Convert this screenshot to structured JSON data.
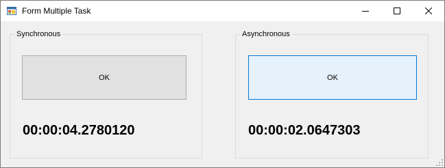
{
  "window": {
    "title": "Form Multiple Task",
    "icons": {
      "app": "form-app-icon",
      "minimize": "minimize-icon",
      "maximize": "maximize-icon",
      "close": "close-icon"
    }
  },
  "groups": {
    "sync": {
      "legend": "Synchronous",
      "button_label": "OK",
      "elapsed": "00:00:04.2780120"
    },
    "async": {
      "legend": "Asynchronous",
      "button_label": "OK",
      "elapsed": "00:00:02.0647303"
    }
  },
  "colors": {
    "accent_border": "#0078d7",
    "focused_button_bg": "#e5f1fb",
    "button_bg": "#e1e1e1",
    "form_bg": "#f0f0f0"
  }
}
